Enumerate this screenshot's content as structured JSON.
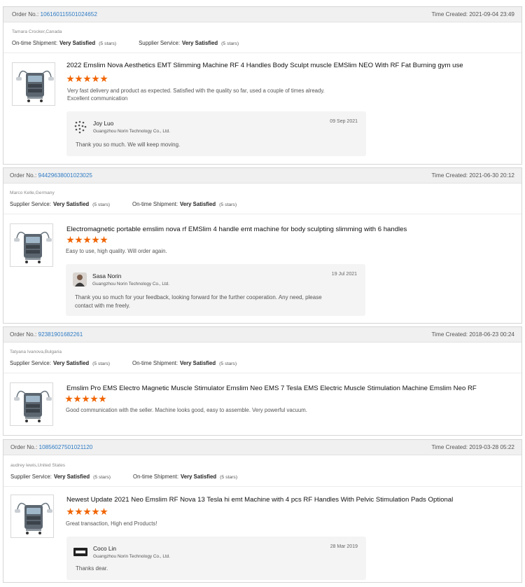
{
  "labels": {
    "order_no": "Order No.:",
    "time_created": "Time Created:",
    "on_time_shipment": "On-time Shipment:",
    "supplier_service": "Supplier Service:",
    "five_stars": "(5 stars)"
  },
  "colors": {
    "star": "#f06400",
    "order_link": "#2f7bc4",
    "header_bg": "#f0f0f0",
    "reply_bg": "#f4f4f4"
  },
  "reviews": [
    {
      "order_number": "106160115501024652",
      "time_created": "2021-09-04 23:49",
      "buyer": "Tamara Crocker,Canada",
      "first_rating_label": "On-time Shipment:",
      "first_rating_value": "Very Satisfied",
      "second_rating_label": "Supplier Service:",
      "second_rating_value": "Very Satisfied",
      "product_title": "2022 Emslim Nova Aesthetics EMT Slimming Machine RF 4 Handles Body Sculpt muscle EMSlim NEO With RF Fat Burning gym use",
      "product_icon": "machine-thumbnail-icon",
      "stars": 5,
      "text_line1": "Very fast delivery and product as expected. Satisfied with the quality so far, used a couple of times already.",
      "text_line2": "Excellent communication",
      "reply": {
        "name": "Joy Luo",
        "company": "Guangzhou Norin Technology Co., Ltd.",
        "date": "09 Sep 2021",
        "text_line1": "Thank you so much. We will keep moving.",
        "text_line2": "",
        "avatar_icon": "dotted-avatar-icon"
      }
    },
    {
      "order_number": "94429638001023025",
      "time_created": "2021-06-30 20:12",
      "buyer": "Marco Kelle,Germany",
      "first_rating_label": "Supplier Service:",
      "first_rating_value": "Very Satisfied",
      "second_rating_label": "On-time Shipment:",
      "second_rating_value": "Very Satisfied",
      "product_title": "Electromagnetic portable emslim nova rf EMSlim 4 handle emt machine for body sculpting slimming with 6 handles",
      "product_icon": "machine-thumbnail-icon",
      "stars": 5,
      "text_line1": "Easy to use, high quality. Will order again.",
      "text_line2": "",
      "reply": {
        "name": "Sasa Norin",
        "company": "Guangzhou Norin Technology Co., Ltd.",
        "date": "19 Jul 2021",
        "text_line1": "Thank you so much for your feedback, looking forward for the further cooperation. Any need, please",
        "text_line2": "contact with me freely.",
        "avatar_icon": "photo-avatar-icon"
      }
    },
    {
      "order_number": "92381901682261",
      "time_created": "2018-06-23 00:24",
      "buyer": "Tatyana Ivanova,Bulgaria",
      "first_rating_label": "Supplier Service:",
      "first_rating_value": "Very Satisfied",
      "second_rating_label": "On-time Shipment:",
      "second_rating_value": "Very Satisfied",
      "product_title": "Emslim Pro EMS Electro Magnetic Muscle Stimulator Emslim Neo EMS 7 Tesla EMS Electric Muscle Stimulation Machine Emslim Neo RF",
      "product_icon": "machine-thumbnail-icon",
      "stars": 5,
      "text_line1": "Good communication with the seller. Machine looks good, easy to assemble. Very powerful vacuum.",
      "text_line2": ""
    },
    {
      "order_number": "10856027501021120",
      "time_created": "2019-03-28 05:22",
      "buyer": "audrey lewis,United States",
      "first_rating_label": "Supplier Service:",
      "first_rating_value": "Very Satisfied",
      "second_rating_label": "On-time Shipment:",
      "second_rating_value": "Very Satisfied",
      "product_title": "Newest Update 2021 Neo Emslim RF Nova 13 Tesla hi emt Machine with 4 pcs RF Handles With Pelvic Stimulation Pads Optional",
      "product_icon": "machine-thumbnail-icon",
      "stars": 5,
      "text_line1": "Great transaction, High end Products!",
      "text_line2": "",
      "reply": {
        "name": "Coco Lin",
        "company": "Guangzhou Norin Technology Co., Ltd.",
        "date": "28 Mar 2019",
        "text_line1": "Thanks dear.",
        "text_line2": "",
        "avatar_icon": "logo-avatar-icon"
      }
    }
  ]
}
